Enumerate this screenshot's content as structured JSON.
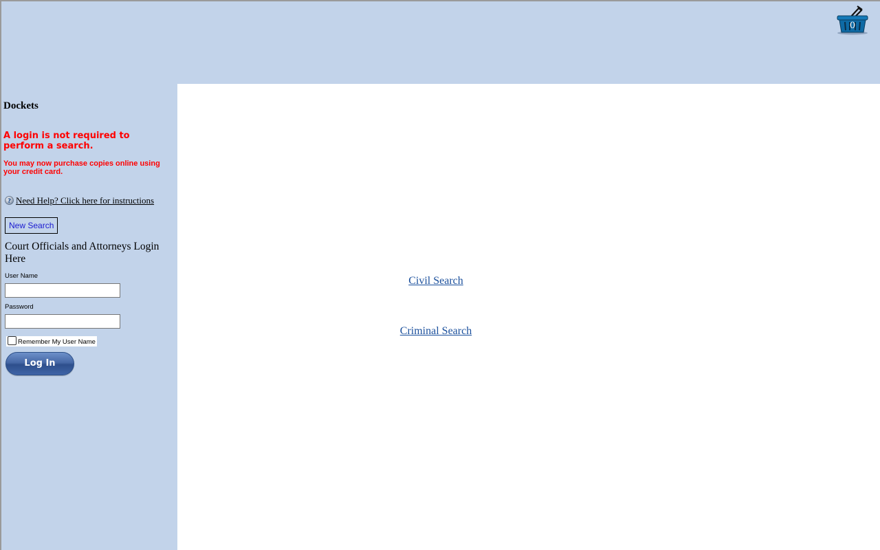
{
  "header": {
    "cart": {
      "icon": "shopping-basket-icon",
      "count": "0"
    }
  },
  "sidebar": {
    "title": "Dockets",
    "notice_primary": "A login is not required to perform a search.",
    "notice_secondary": "You may now purchase copies online using your credit card.",
    "help_icon": "question-circle-icon",
    "help_link": "Need Help? Click here for instructions",
    "new_search_label": "New Search",
    "login_heading": "Court Officials and Attorneys Login Here",
    "username_label": "User Name",
    "username_value": "",
    "password_label": "Password",
    "password_value": "",
    "remember_label": "Remember My User Name",
    "remember_checked": false,
    "login_button_label": "Log In"
  },
  "main": {
    "civil_search": "Civil Search",
    "criminal_search": "Criminal Search"
  },
  "colors": {
    "panel_background": "#c2d3ea",
    "notice_red": "#ff0000",
    "link_blue": "#1a4f9c",
    "new_search_blue": "#1a1ad0",
    "login_button_blue": "#3f64a6"
  }
}
